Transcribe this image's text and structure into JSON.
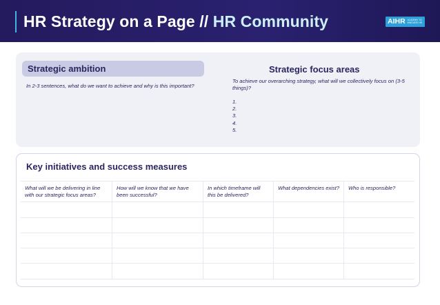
{
  "header": {
    "title_part1": "HR Strategy on a Page //",
    "title_part2": "HR Community",
    "logo_text": "AIHR",
    "logo_subtext": "Academy to Innovate HR"
  },
  "ambition": {
    "title": "Strategic ambition",
    "question": "In 2-3 sentences, what do we want to achieve and why is this important?"
  },
  "focus": {
    "title": "Strategic focus areas",
    "question": "To achieve our overarching strategy, what will we collectively focus on (3-5 things)?",
    "items": [
      "1.",
      "2.",
      "3.",
      "4.",
      "5."
    ]
  },
  "initiatives": {
    "title": "Key initiatives and success measures",
    "columns": [
      "What will we be delivering in line with our strategic focus areas?",
      "How will we know that we have been successful?",
      "In which timeframe will this be delivered?",
      "What dependencies exist?",
      "Who is responsible?"
    ]
  },
  "colors": {
    "banner": "#241a5e",
    "accent": "#3fb6e8",
    "text": "#2a2560",
    "panel": "#f0f1f7",
    "pill": "#c8cbe3"
  }
}
